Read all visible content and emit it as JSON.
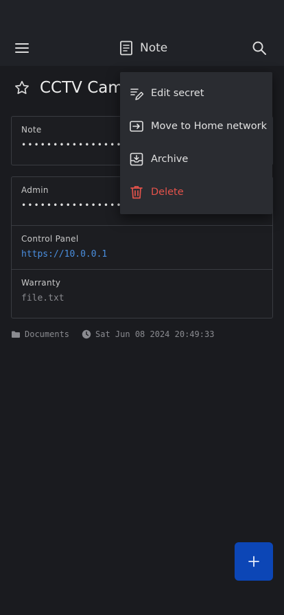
{
  "app_bar": {
    "title": "Note",
    "menu_icon": "hamburger-menu-icon",
    "title_icon": "note-icon",
    "search_icon": "search-icon"
  },
  "secret": {
    "title": "CCTV Camera",
    "favorite_icon": "star-outline-icon"
  },
  "fields": {
    "note": {
      "label": "Note",
      "value": "••••••••••••••••"
    },
    "admin": {
      "label": "Admin",
      "value": "••••••••••••••••"
    },
    "control_panel": {
      "label": "Control Panel",
      "value": "https://10.0.0.1"
    },
    "warranty": {
      "label": "Warranty",
      "value": "file.txt"
    }
  },
  "meta": {
    "folder": "Documents",
    "modified": "Sat Jun 08 2024 20:49:33"
  },
  "menu": {
    "items": [
      {
        "label": "Edit secret",
        "icon": "edit-pencil-icon"
      },
      {
        "label": "Move to Home network",
        "icon": "move-arrow-icon"
      },
      {
        "label": "Archive",
        "icon": "archive-icon"
      },
      {
        "label": "Delete",
        "icon": "trash-icon"
      }
    ]
  },
  "colors": {
    "background": "#1a1b1f",
    "link": "#4a8fe0",
    "danger": "#e5534b",
    "fab": "#0c46b6"
  }
}
